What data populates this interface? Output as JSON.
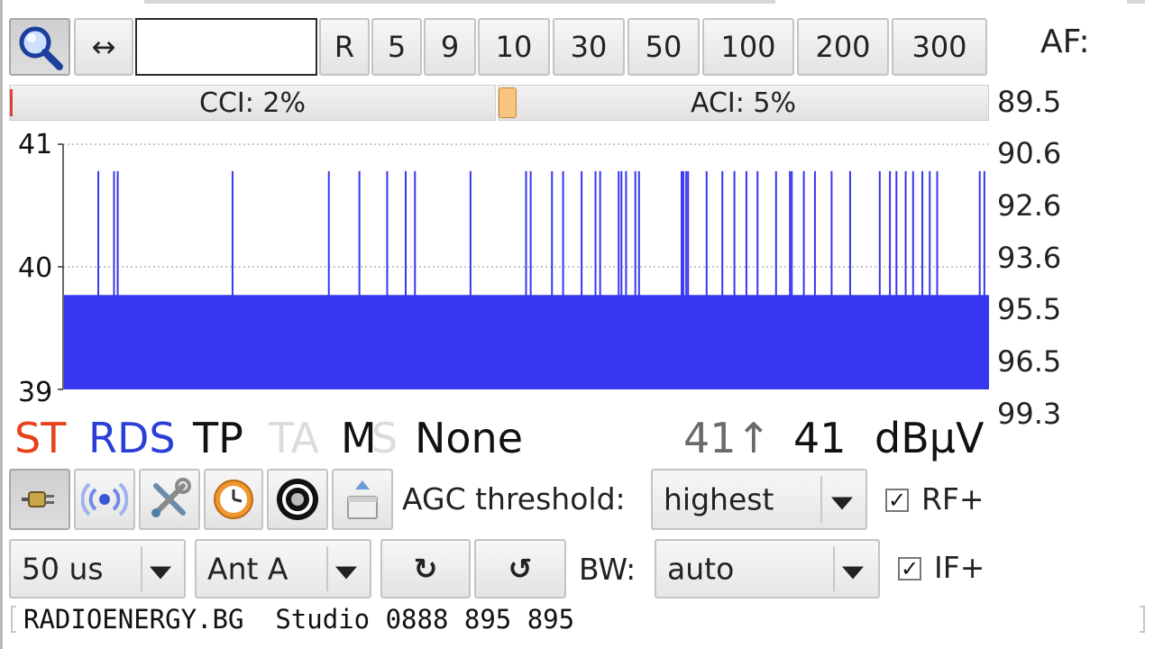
{
  "toolbar": {
    "search_icon": "magnifier-icon",
    "swap_label": "↔",
    "frequency_input": {
      "value": "",
      "placeholder": ""
    },
    "buttons": [
      "R",
      "5",
      "9",
      "10",
      "30",
      "50",
      "100",
      "200",
      "300"
    ]
  },
  "af": {
    "label": "AF:",
    "frequencies": [
      "89.5",
      "90.6",
      "92.6",
      "93.6",
      "95.5",
      "96.5",
      "99.3"
    ]
  },
  "meters": {
    "cci_label": "CCI: 2%",
    "aci_label": "ACI: 5%",
    "cci_percent": 2,
    "aci_percent": 5
  },
  "chart_data": {
    "type": "area",
    "y_ticks": [
      "41",
      "40",
      "39"
    ],
    "ylim": [
      39,
      41
    ],
    "baseline": 39.77,
    "spike_value": 40.78,
    "spike_fractions": [
      0.038,
      0.055,
      0.059,
      0.183,
      0.287,
      0.32,
      0.35,
      0.37,
      0.38,
      0.44,
      0.5,
      0.505,
      0.528,
      0.54,
      0.56,
      0.575,
      0.58,
      0.6,
      0.603,
      0.608,
      0.618,
      0.622,
      0.668,
      0.67,
      0.673,
      0.675,
      0.695,
      0.712,
      0.725,
      0.738,
      0.75,
      0.77,
      0.785,
      0.787,
      0.8,
      0.812,
      0.83,
      0.85,
      0.882,
      0.893,
      0.9,
      0.91,
      0.918,
      0.928,
      0.936,
      0.944,
      0.99,
      0.995
    ],
    "fill_color": "#3737f0",
    "grid": true
  },
  "status": {
    "st": "ST",
    "rds": "RDS",
    "tp": "TP",
    "ta": "TA",
    "m": "M",
    "s": "S",
    "pty": "None",
    "max_level": "41↑",
    "level": "41",
    "unit": "dBµV",
    "colors": {
      "st": "#e8421c",
      "rds": "#2b3fd6",
      "ta_inactive": "#dcdcdc",
      "max_level": "#6a6a6a"
    }
  },
  "controls": {
    "agc_label": "AGC threshold:",
    "agc_value": "highest",
    "rf_plus_label": "RF+",
    "rf_plus_checked": true,
    "deemphasis_value": "50 us",
    "antenna_value": "Ant A",
    "rotate_cw_label": "↻",
    "rotate_ccw_label": "↺",
    "bw_label": "BW:",
    "bw_value": "auto",
    "if_plus_label": "IF+",
    "if_plus_checked": true,
    "icons": [
      "plug-icon",
      "rds-signal-icon",
      "tools-icon",
      "clock-icon",
      "record-disc-icon",
      "eject-icon"
    ]
  },
  "radiotext": "RADIOENERGY.BG  Studio 0888 895 895"
}
